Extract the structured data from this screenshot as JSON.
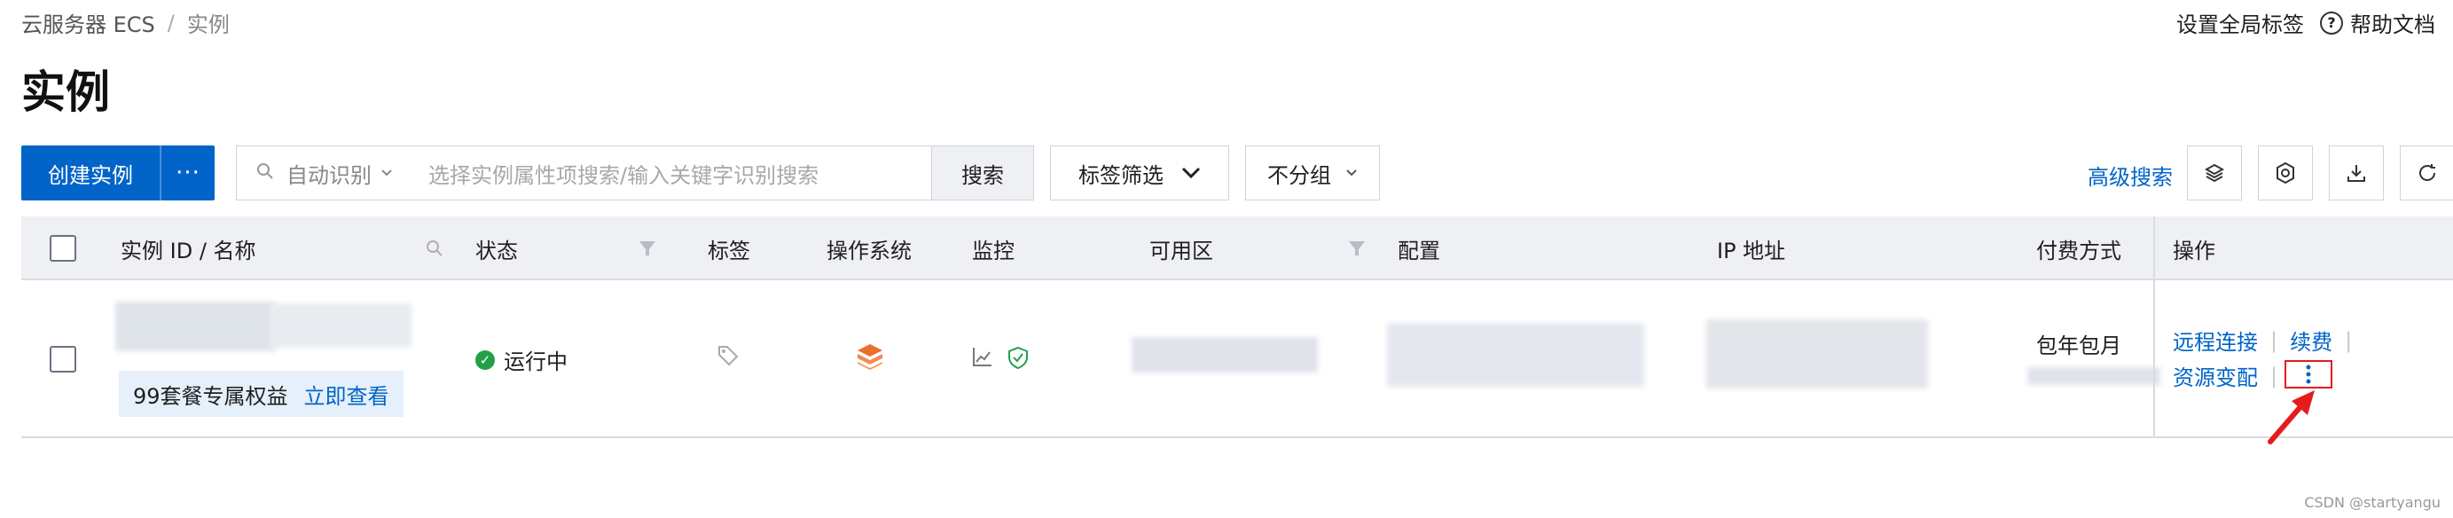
{
  "breadcrumb": {
    "root": "云服务器 ECS",
    "separator": "/",
    "current": "实例"
  },
  "top_right": {
    "global_tags": "设置全局标签",
    "help_docs": "帮助文档"
  },
  "page_title": "实例",
  "toolbar": {
    "create_label": "创建实例",
    "more_label": "···",
    "auto_detect": "自动识别",
    "search_placeholder": "选择实例属性项搜索/输入关键字识别搜索",
    "search_button": "搜索",
    "tag_filter": "标签筛选",
    "no_group": "不分组",
    "advanced_search": "高级搜索"
  },
  "table": {
    "headers": {
      "id_name": "实例 ID / 名称",
      "status": "状态",
      "tags": "标签",
      "os": "操作系统",
      "monitor": "监控",
      "zone": "可用区",
      "config": "配置",
      "ip": "IP 地址",
      "billing": "付费方式",
      "actions": "操作"
    },
    "row": {
      "promo_text": "99套餐专属权益",
      "promo_link": "立即查看",
      "status": "运行中",
      "billing": "包年包月",
      "action_remote": "远程连接",
      "action_renew": "续费",
      "action_resize": "资源变配",
      "separator": "|"
    }
  },
  "watermark": "CSDN @startyangu",
  "colors": {
    "primary": "#0064c8",
    "success": "#23a047",
    "highlight": "#e51c1c",
    "os_icon": "#e8702a"
  }
}
